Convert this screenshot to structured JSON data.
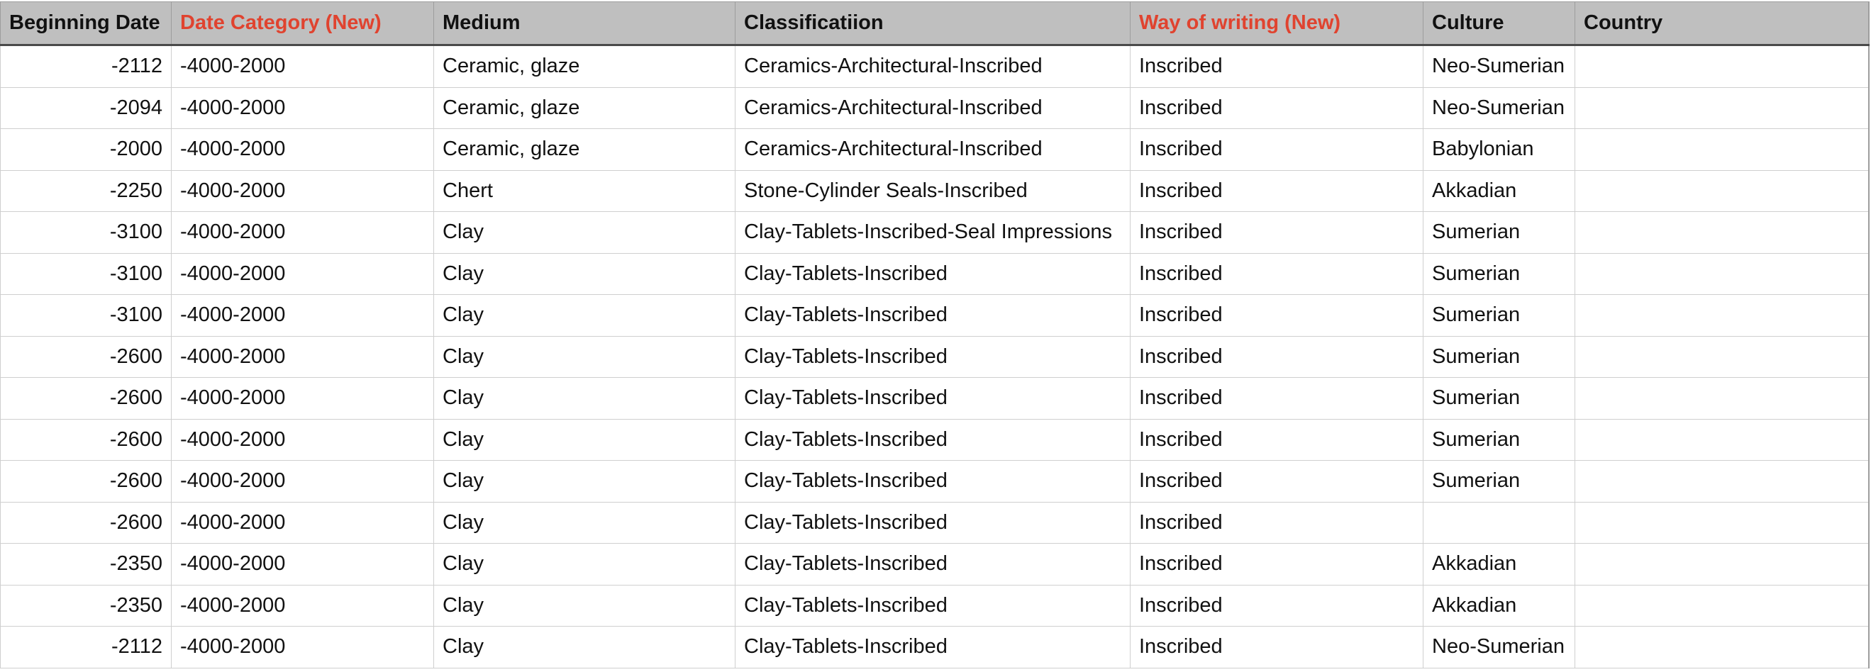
{
  "table": {
    "headers": [
      "Beginning Date",
      "Date Category (New)",
      "Medium",
      "Classificatiion",
      "Way of writing (New)",
      "Culture",
      "Country"
    ],
    "highlight_color": "#e0432f",
    "rows": [
      [
        "-2112",
        "-4000-2000",
        "Ceramic, glaze",
        "Ceramics-Architectural-Inscribed",
        "Inscribed",
        "Neo-Sumerian",
        ""
      ],
      [
        "-2094",
        "-4000-2000",
        "Ceramic, glaze",
        "Ceramics-Architectural-Inscribed",
        "Inscribed",
        "Neo-Sumerian",
        ""
      ],
      [
        "-2000",
        "-4000-2000",
        "Ceramic, glaze",
        "Ceramics-Architectural-Inscribed",
        "Inscribed",
        "Babylonian",
        ""
      ],
      [
        "-2250",
        "-4000-2000",
        "Chert",
        "Stone-Cylinder Seals-Inscribed",
        "Inscribed",
        "Akkadian",
        ""
      ],
      [
        "-3100",
        "-4000-2000",
        "Clay",
        "Clay-Tablets-Inscribed-Seal Impressions",
        "Inscribed",
        "Sumerian",
        ""
      ],
      [
        "-3100",
        "-4000-2000",
        "Clay",
        "Clay-Tablets-Inscribed",
        "Inscribed",
        "Sumerian",
        ""
      ],
      [
        "-3100",
        "-4000-2000",
        "Clay",
        "Clay-Tablets-Inscribed",
        "Inscribed",
        "Sumerian",
        ""
      ],
      [
        "-2600",
        "-4000-2000",
        "Clay",
        "Clay-Tablets-Inscribed",
        "Inscribed",
        "Sumerian",
        ""
      ],
      [
        "-2600",
        "-4000-2000",
        "Clay",
        "Clay-Tablets-Inscribed",
        "Inscribed",
        "Sumerian",
        ""
      ],
      [
        "-2600",
        "-4000-2000",
        "Clay",
        "Clay-Tablets-Inscribed",
        "Inscribed",
        "Sumerian",
        ""
      ],
      [
        "-2600",
        "-4000-2000",
        "Clay",
        "Clay-Tablets-Inscribed",
        "Inscribed",
        "Sumerian",
        ""
      ],
      [
        "-2600",
        "-4000-2000",
        "Clay",
        "Clay-Tablets-Inscribed",
        "Inscribed",
        "",
        ""
      ],
      [
        "-2350",
        "-4000-2000",
        "Clay",
        "Clay-Tablets-Inscribed",
        "Inscribed",
        "Akkadian",
        ""
      ],
      [
        "-2350",
        "-4000-2000",
        "Clay",
        "Clay-Tablets-Inscribed",
        "Inscribed",
        "Akkadian",
        ""
      ],
      [
        "-2112",
        "-4000-2000",
        "Clay",
        "Clay-Tablets-Inscribed",
        "Inscribed",
        "Neo-Sumerian",
        ""
      ]
    ]
  }
}
